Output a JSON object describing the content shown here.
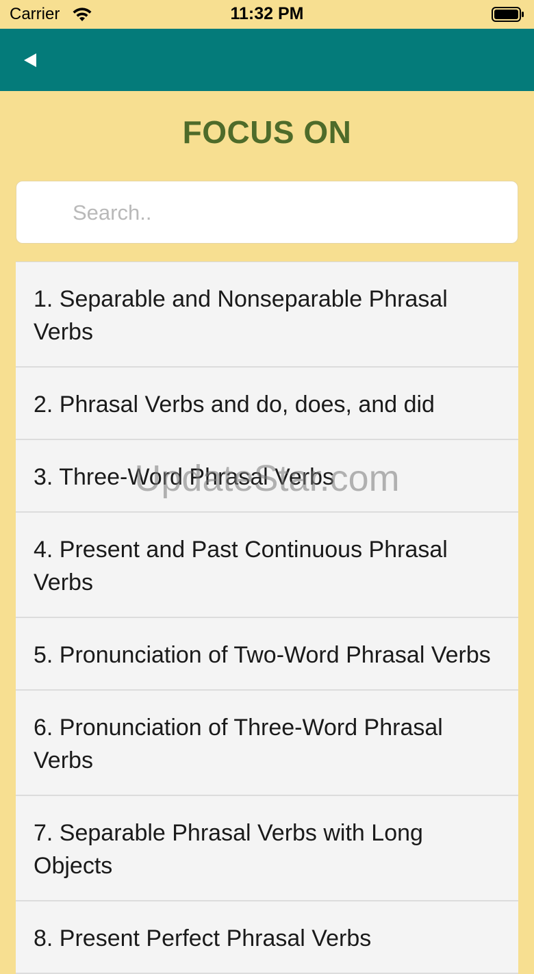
{
  "status_bar": {
    "carrier": "Carrier",
    "time": "11:32 PM",
    "wifi_icon": "wifi-icon",
    "battery_icon": "battery-icon"
  },
  "nav": {
    "back_icon": "back-triangle-icon",
    "color": "#047b7a"
  },
  "page": {
    "title": "FOCUS ON",
    "background": "#f7df91",
    "title_color": "#4e6b2a"
  },
  "search": {
    "placeholder": "Search..",
    "value": ""
  },
  "items": [
    "1. Separable and Nonseparable Phrasal Verbs",
    "2. Phrasal Verbs and do, does, and did",
    "3. Three-Word Phrasal Verbs",
    "4. Present and Past Continuous Phrasal Verbs",
    "5. Pronunciation of Two-Word Phrasal Verbs",
    "6. Pronunciation of Three-Word Phrasal Verbs",
    "7. Separable Phrasal Verbs with Long Objects",
    "8. Present Perfect Phrasal Verbs"
  ],
  "watermark": "UpdateStar.com"
}
